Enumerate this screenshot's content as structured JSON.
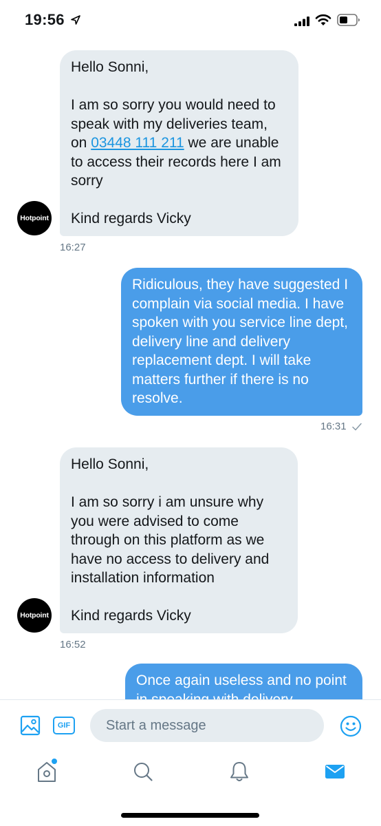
{
  "status_bar": {
    "time": "19:56"
  },
  "messages": [
    {
      "direction": "incoming",
      "paragraphs": [
        "Hello Sonni,",
        "I am so sorry you would need to speak with my deliveries team, on",
        "03448 111 211",
        "we are unable to access their records here I am sorry",
        "Kind regards Vicky"
      ],
      "avatar_label": "Hotpoint",
      "time": "16:27"
    },
    {
      "direction": "outgoing",
      "text": "Ridiculous, they have suggested I complain via social media. I have spoken with you service line dept, delivery line and delivery replacement dept. I will take matters further if there is no resolve.",
      "time": "16:31"
    },
    {
      "direction": "incoming",
      "text": "Hello Sonni,\n\nI am so sorry i am unsure why you were advised to come through on this platform as we have no access to delivery and installation information\n\nKind regards Vicky",
      "avatar_label": "Hotpoint",
      "time": "16:52"
    },
    {
      "direction": "outgoing",
      "text": "Once again useless and no point in speaking with delivery"
    }
  ],
  "composer": {
    "gif_label": "GIF",
    "placeholder": "Start a message"
  },
  "tab_bar": {
    "items": [
      "home-icon",
      "search-icon",
      "bell-icon",
      "mail-icon"
    ]
  },
  "colors": {
    "accent": "#1da1f2",
    "outgoing_bubble": "#4a9de9",
    "incoming_bubble": "#e6ecf0"
  }
}
